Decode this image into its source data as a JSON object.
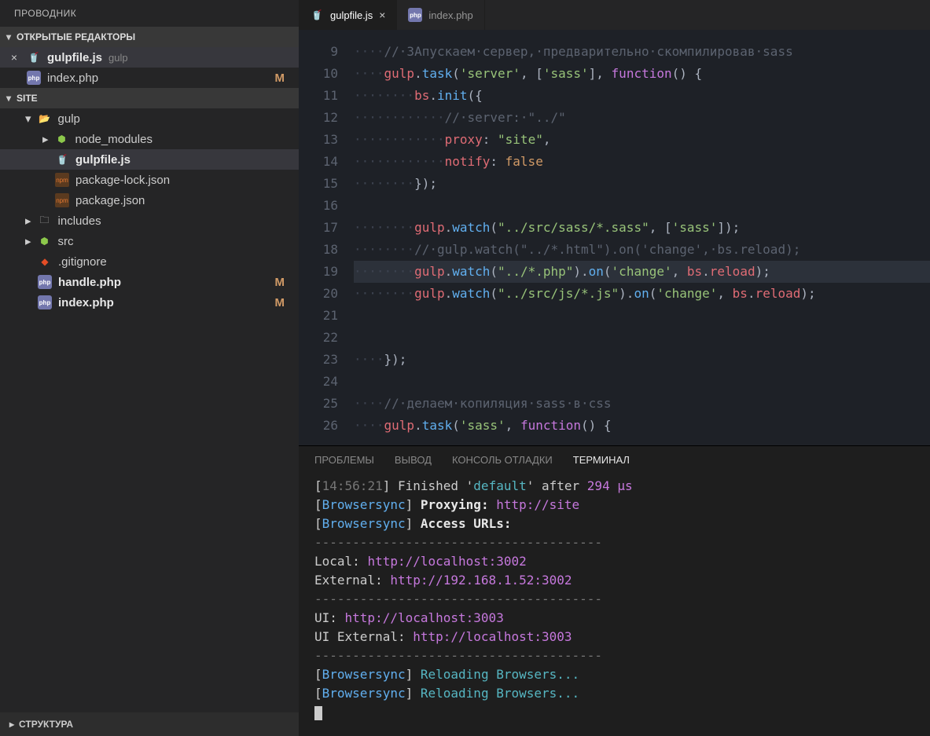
{
  "sidebar": {
    "title": "ПРОВОДНИК",
    "openEditorsHeader": "ОТКРЫТЫЕ РЕДАКТОРЫ",
    "openEditors": [
      {
        "name": "gulpfile.js",
        "folder": "gulp",
        "icon": "gulp",
        "modified": false,
        "closeVisible": true,
        "selected": true
      },
      {
        "name": "index.php",
        "folder": "",
        "icon": "php",
        "modified": true,
        "closeVisible": false,
        "selected": false
      }
    ],
    "workspaceHeader": "SITE",
    "tree": [
      {
        "depth": 1,
        "label": "gulp",
        "icon": "folder-open",
        "chev": "down"
      },
      {
        "depth": 2,
        "label": "node_modules",
        "icon": "node",
        "chev": "right"
      },
      {
        "depth": 2,
        "label": "gulpfile.js",
        "icon": "gulp",
        "selected": true,
        "bold": true
      },
      {
        "depth": 2,
        "label": "package-lock.json",
        "icon": "json"
      },
      {
        "depth": 2,
        "label": "package.json",
        "icon": "json"
      },
      {
        "depth": 1,
        "label": "includes",
        "icon": "includes",
        "chev": "right"
      },
      {
        "depth": 1,
        "label": "src",
        "icon": "src",
        "chev": "right"
      },
      {
        "depth": 1,
        "label": ".gitignore",
        "icon": "git"
      },
      {
        "depth": 1,
        "label": "handle.php",
        "icon": "php",
        "modified": true,
        "bold": true
      },
      {
        "depth": 1,
        "label": "index.php",
        "icon": "php",
        "modified": true,
        "bold": true
      }
    ],
    "structureHeader": "СТРУКТУРА"
  },
  "tabs": [
    {
      "label": "gulpfile.js",
      "icon": "gulp",
      "active": true,
      "close": true
    },
    {
      "label": "index.php",
      "icon": "php",
      "active": false,
      "close": false
    }
  ],
  "editor": {
    "startLine": 9,
    "highlightLine": 19,
    "lines": [
      [
        {
          "t": "ws",
          "v": "····"
        },
        {
          "t": "comment",
          "v": "//·ЗАпускаем·сервер,·предварительно·скомпилировав·sass"
        }
      ],
      [
        {
          "t": "ws",
          "v": "····"
        },
        {
          "t": "ident",
          "v": "gulp"
        },
        {
          "t": "punc",
          "v": "."
        },
        {
          "t": "func",
          "v": "task"
        },
        {
          "t": "punc",
          "v": "("
        },
        {
          "t": "str",
          "v": "'server'"
        },
        {
          "t": "punc",
          "v": ", ["
        },
        {
          "t": "str",
          "v": "'sass'"
        },
        {
          "t": "punc",
          "v": "], "
        },
        {
          "t": "kw",
          "v": "function"
        },
        {
          "t": "punc",
          "v": "()"
        },
        {
          "t": "punc",
          "v": " {"
        }
      ],
      [
        {
          "t": "ws",
          "v": "········"
        },
        {
          "t": "ident",
          "v": "bs"
        },
        {
          "t": "punc",
          "v": "."
        },
        {
          "t": "func",
          "v": "init"
        },
        {
          "t": "punc",
          "v": "({"
        }
      ],
      [
        {
          "t": "ws",
          "v": "············"
        },
        {
          "t": "comment",
          "v": "//·server:·\"../\""
        }
      ],
      [
        {
          "t": "ws",
          "v": "············"
        },
        {
          "t": "ident",
          "v": "proxy"
        },
        {
          "t": "punc",
          "v": ": "
        },
        {
          "t": "str",
          "v": "\"site\""
        },
        {
          "t": "punc",
          "v": ","
        }
      ],
      [
        {
          "t": "ws",
          "v": "············"
        },
        {
          "t": "ident",
          "v": "notify"
        },
        {
          "t": "punc",
          "v": ": "
        },
        {
          "t": "const",
          "v": "false"
        }
      ],
      [
        {
          "t": "ws",
          "v": "········"
        },
        {
          "t": "punc",
          "v": "});"
        }
      ],
      [],
      [
        {
          "t": "ws",
          "v": "········"
        },
        {
          "t": "ident",
          "v": "gulp"
        },
        {
          "t": "punc",
          "v": "."
        },
        {
          "t": "func",
          "v": "watch"
        },
        {
          "t": "punc",
          "v": "("
        },
        {
          "t": "str",
          "v": "\"../src/sass/*.sass\""
        },
        {
          "t": "punc",
          "v": ", ["
        },
        {
          "t": "str",
          "v": "'sass'"
        },
        {
          "t": "punc",
          "v": "]);"
        }
      ],
      [
        {
          "t": "ws",
          "v": "········"
        },
        {
          "t": "comment",
          "v": "//·gulp.watch(\"../*.html\").on('change',·bs.reload);"
        }
      ],
      [
        {
          "t": "ws",
          "v": "········"
        },
        {
          "t": "ident",
          "v": "gulp"
        },
        {
          "t": "punc",
          "v": "."
        },
        {
          "t": "func",
          "v": "watch"
        },
        {
          "t": "punc",
          "v": "("
        },
        {
          "t": "str",
          "v": "\"../*.php\""
        },
        {
          "t": "punc",
          "v": ")."
        },
        {
          "t": "func",
          "v": "on"
        },
        {
          "t": "punc",
          "v": "("
        },
        {
          "t": "str",
          "v": "'change'"
        },
        {
          "t": "punc",
          "v": ", "
        },
        {
          "t": "ident",
          "v": "bs"
        },
        {
          "t": "punc",
          "v": "."
        },
        {
          "t": "ident",
          "v": "reload"
        },
        {
          "t": "punc",
          "v": ");"
        }
      ],
      [
        {
          "t": "ws",
          "v": "········"
        },
        {
          "t": "ident",
          "v": "gulp"
        },
        {
          "t": "punc",
          "v": "."
        },
        {
          "t": "func",
          "v": "watch"
        },
        {
          "t": "punc",
          "v": "("
        },
        {
          "t": "str",
          "v": "\"../src/js/*.js\""
        },
        {
          "t": "punc",
          "v": ")."
        },
        {
          "t": "func",
          "v": "on"
        },
        {
          "t": "punc",
          "v": "("
        },
        {
          "t": "str",
          "v": "'change'"
        },
        {
          "t": "punc",
          "v": ", "
        },
        {
          "t": "ident",
          "v": "bs"
        },
        {
          "t": "punc",
          "v": "."
        },
        {
          "t": "ident",
          "v": "reload"
        },
        {
          "t": "punc",
          "v": ");"
        }
      ],
      [],
      [],
      [
        {
          "t": "ws",
          "v": "····"
        },
        {
          "t": "punc",
          "v": "});"
        }
      ],
      [],
      [
        {
          "t": "ws",
          "v": "····"
        },
        {
          "t": "comment",
          "v": "//·делаем·копиляция·sass·в·css"
        }
      ],
      [
        {
          "t": "ws",
          "v": "····"
        },
        {
          "t": "ident",
          "v": "gulp"
        },
        {
          "t": "punc",
          "v": "."
        },
        {
          "t": "func",
          "v": "task"
        },
        {
          "t": "punc",
          "v": "("
        },
        {
          "t": "str",
          "v": "'sass'"
        },
        {
          "t": "punc",
          "v": ", "
        },
        {
          "t": "kw",
          "v": "function"
        },
        {
          "t": "punc",
          "v": "()"
        },
        {
          "t": "punc",
          "v": " {"
        }
      ]
    ]
  },
  "panelTabs": [
    "ПРОБЛЕМЫ",
    "ВЫВОД",
    "КОНСОЛЬ ОТЛАДКИ",
    "ТЕРМИНАЛ"
  ],
  "activePanelTab": 3,
  "terminal": [
    [
      {
        "t": "punc",
        "v": "["
      },
      {
        "t": "gray",
        "v": "14:56:21"
      },
      {
        "t": "punc",
        "v": "] Finished '"
      },
      {
        "t": "cyan",
        "v": "default"
      },
      {
        "t": "punc",
        "v": "' after "
      },
      {
        "t": "mag",
        "v": "294 μs"
      }
    ],
    [
      {
        "t": "punc",
        "v": "["
      },
      {
        "t": "blue",
        "v": "Browsersync"
      },
      {
        "t": "punc",
        "v": "] "
      },
      {
        "t": "white",
        "v": "Proxying: "
      },
      {
        "t": "mag",
        "v": "http://site"
      }
    ],
    [
      {
        "t": "punc",
        "v": "["
      },
      {
        "t": "blue",
        "v": "Browsersync"
      },
      {
        "t": "punc",
        "v": "] "
      },
      {
        "t": "white",
        "v": "Access URLs:"
      }
    ],
    [
      {
        "t": "gray",
        "v": " --------------------------------------"
      }
    ],
    [
      {
        "t": "punc",
        "v": "       Local: "
      },
      {
        "t": "mag",
        "v": "http://localhost:3002"
      }
    ],
    [
      {
        "t": "punc",
        "v": "    External: "
      },
      {
        "t": "mag",
        "v": "http://192.168.1.52:3002"
      }
    ],
    [
      {
        "t": "gray",
        "v": " --------------------------------------"
      }
    ],
    [
      {
        "t": "punc",
        "v": "          UI: "
      },
      {
        "t": "mag",
        "v": "http://localhost:3003"
      }
    ],
    [
      {
        "t": "punc",
        "v": " UI External: "
      },
      {
        "t": "mag",
        "v": "http://localhost:3003"
      }
    ],
    [
      {
        "t": "gray",
        "v": " --------------------------------------"
      }
    ],
    [
      {
        "t": "punc",
        "v": "["
      },
      {
        "t": "blue",
        "v": "Browsersync"
      },
      {
        "t": "punc",
        "v": "] "
      },
      {
        "t": "cyan",
        "v": "Reloading Browsers..."
      }
    ],
    [
      {
        "t": "punc",
        "v": "["
      },
      {
        "t": "blue",
        "v": "Browsersync"
      },
      {
        "t": "punc",
        "v": "] "
      },
      {
        "t": "cyan",
        "v": "Reloading Browsers..."
      }
    ]
  ]
}
